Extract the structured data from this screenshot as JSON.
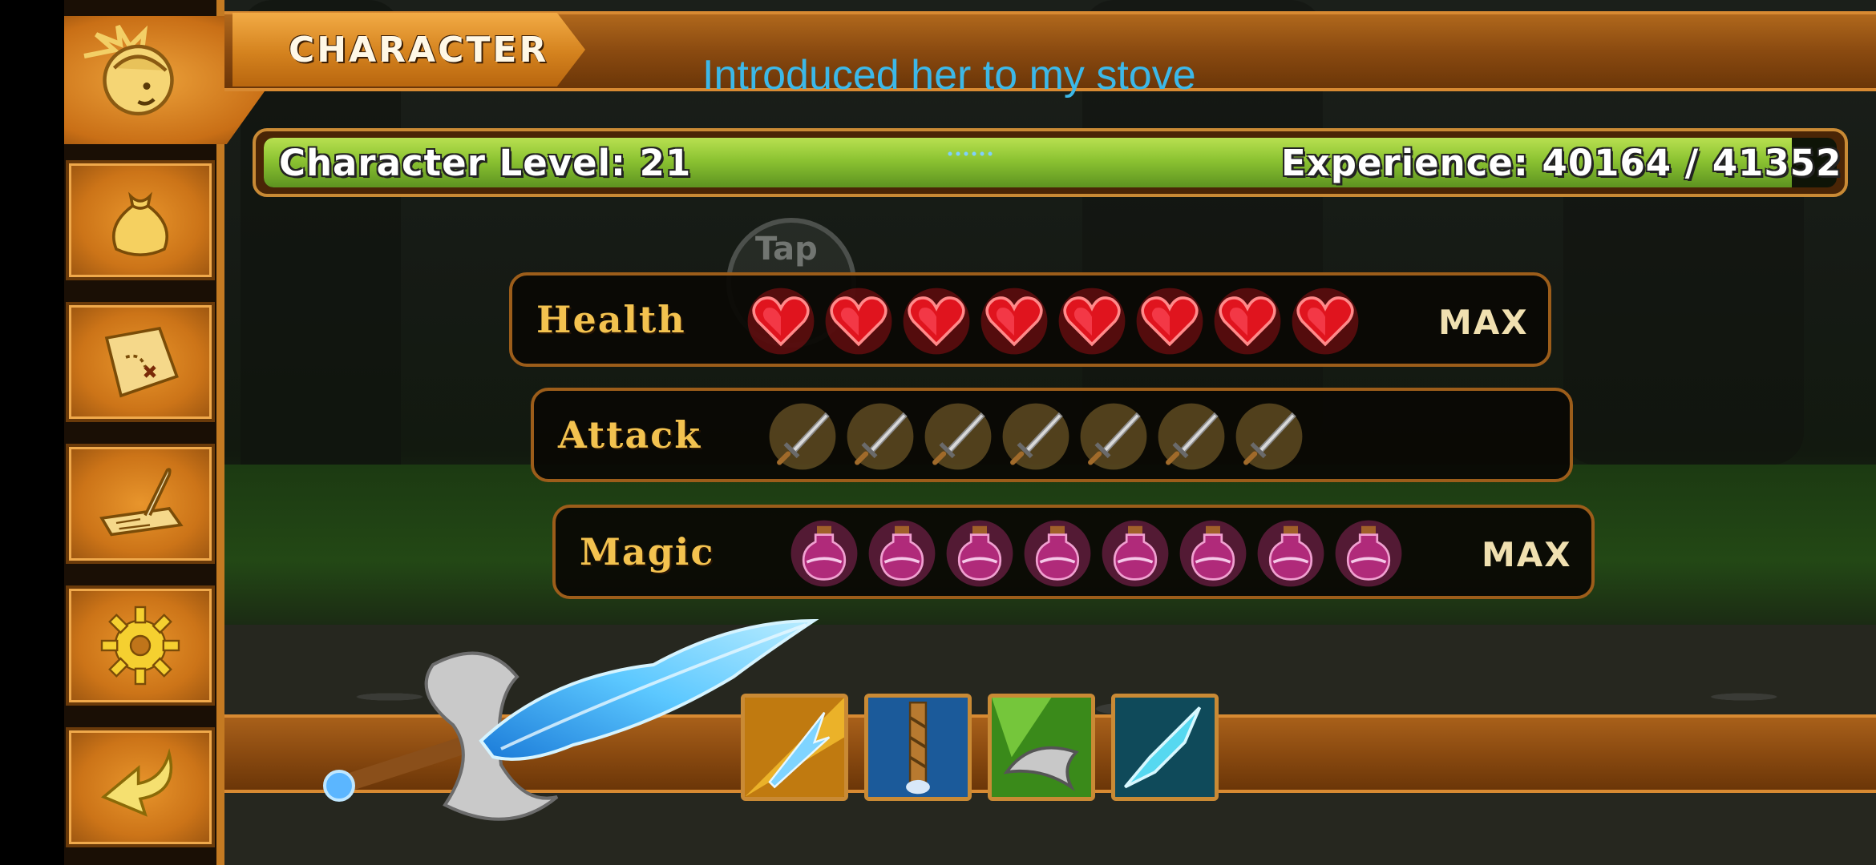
{
  "header": {
    "title": "CHARACTER",
    "notice": "Introduced her to my stove"
  },
  "sidebar": {
    "items": [
      {
        "name": "character",
        "icon": "character-portrait-icon"
      },
      {
        "name": "inventory",
        "icon": "money-bag-icon"
      },
      {
        "name": "map",
        "icon": "treasure-map-icon"
      },
      {
        "name": "quests",
        "icon": "quill-scroll-icon"
      },
      {
        "name": "settings",
        "icon": "gear-icon"
      },
      {
        "name": "back",
        "icon": "back-arrow-icon"
      }
    ]
  },
  "experience": {
    "level_text": "Character Level: 21",
    "xp_text": "Experience: 40164 / 41352",
    "current": 40164,
    "max": 41352,
    "fill_color": "#8cc332"
  },
  "tap_hint": "Tap",
  "stats": [
    {
      "label": "Health",
      "count": 8,
      "icon": "heart-icon",
      "max_label": "MAX",
      "color": "#e0141e"
    },
    {
      "label": "Attack",
      "count": 7,
      "icon": "sword-icon",
      "max_label": "",
      "color": "#d8a84a"
    },
    {
      "label": "Magic",
      "count": 8,
      "icon": "potion-icon",
      "max_label": "MAX",
      "color": "#c0307a"
    }
  ],
  "weapons": {
    "equipped": "crystal-sword-icon",
    "slots": [
      "gold-lightning-blade-icon",
      "blue-hilt-sword-icon",
      "green-axe-icon",
      "ice-crystal-sword-icon"
    ]
  }
}
